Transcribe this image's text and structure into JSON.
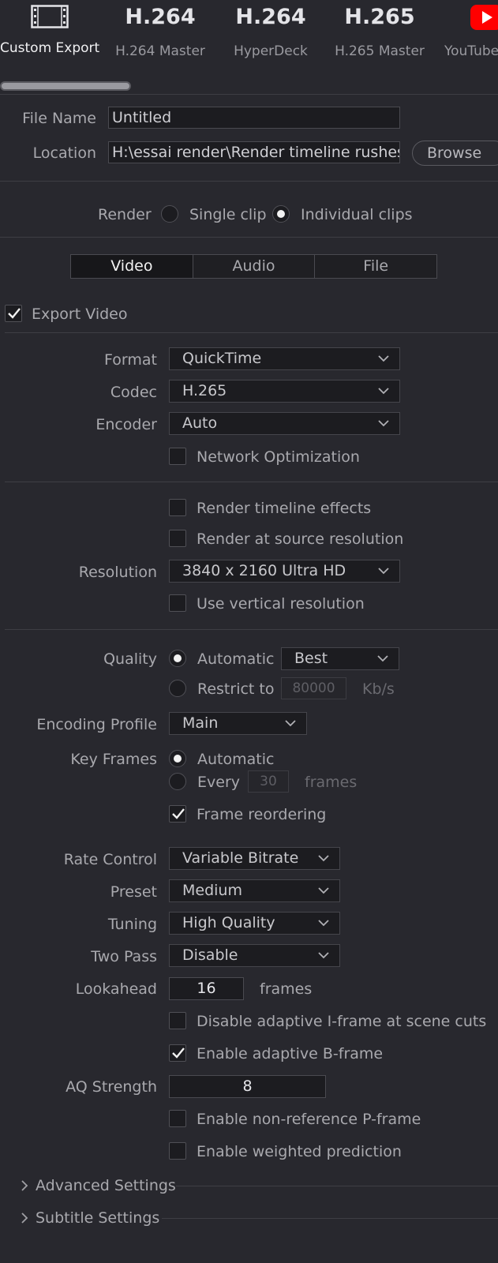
{
  "presets": [
    {
      "label": "Custom Export",
      "big": "",
      "icon": "film-strip-icon"
    },
    {
      "label": "H.264 Master",
      "big": "H.264"
    },
    {
      "label": "HyperDeck",
      "big": "H.264"
    },
    {
      "label": "H.265 Master",
      "big": "H.265"
    },
    {
      "label": "YouTube",
      "big": "",
      "icon": "youtube-icon"
    }
  ],
  "file_name": {
    "label": "File Name",
    "value": "Untitled"
  },
  "location": {
    "label": "Location",
    "value": "H:\\essai render\\Render timeline rushes Fl",
    "browse_label": "Browse"
  },
  "render": {
    "label": "Render",
    "single_clip": "Single clip",
    "individual_clips": "Individual clips",
    "selected": "individual_clips"
  },
  "tabs": [
    {
      "label": "Video",
      "active": true
    },
    {
      "label": "Audio",
      "active": false
    },
    {
      "label": "File",
      "active": false
    }
  ],
  "export_video": {
    "label": "Export Video",
    "checked": true
  },
  "format": {
    "label": "Format",
    "value": "QuickTime"
  },
  "codec": {
    "label": "Codec",
    "value": "H.265"
  },
  "encoder": {
    "label": "Encoder",
    "value": "Auto"
  },
  "network_optimization": {
    "label": "Network Optimization",
    "checked": false
  },
  "render_timeline_effects": {
    "label": "Render timeline effects",
    "checked": false
  },
  "render_source_resolution": {
    "label": "Render at source resolution",
    "checked": false
  },
  "resolution": {
    "label": "Resolution",
    "value": "3840 x 2160 Ultra HD"
  },
  "vertical_resolution": {
    "label": "Use vertical resolution",
    "checked": false
  },
  "quality": {
    "label": "Quality",
    "automatic": "Automatic",
    "automatic_value": "Best",
    "restrict_to": "Restrict to",
    "restrict_value": "80000",
    "unit": "Kb/s",
    "selected": "automatic"
  },
  "encoding_profile": {
    "label": "Encoding Profile",
    "value": "Main"
  },
  "key_frames": {
    "label": "Key Frames",
    "automatic": "Automatic",
    "every": "Every",
    "every_value": "30",
    "unit": "frames",
    "selected": "automatic"
  },
  "frame_reordering": {
    "label": "Frame reordering",
    "checked": true
  },
  "rate_control": {
    "label": "Rate Control",
    "value": "Variable Bitrate"
  },
  "preset": {
    "label": "Preset",
    "value": "Medium"
  },
  "tuning": {
    "label": "Tuning",
    "value": "High Quality"
  },
  "two_pass": {
    "label": "Two Pass",
    "value": "Disable"
  },
  "lookahead": {
    "label": "Lookahead",
    "value": "16",
    "unit": "frames"
  },
  "disable_adaptive_i": {
    "label": "Disable adaptive I-frame at scene cuts",
    "checked": false
  },
  "enable_adaptive_b": {
    "label": "Enable adaptive B-frame",
    "checked": true
  },
  "aq_strength": {
    "label": "AQ Strength",
    "value": "8"
  },
  "non_reference_p": {
    "label": "Enable non-reference P-frame",
    "checked": false
  },
  "weighted_prediction": {
    "label": "Enable weighted prediction",
    "checked": false
  },
  "advanced_settings": {
    "label": "Advanced Settings"
  },
  "subtitle_settings": {
    "label": "Subtitle Settings"
  },
  "colors": {
    "accent_red": "#ff0000",
    "background": "#28282e",
    "field": "#1c1c20"
  }
}
